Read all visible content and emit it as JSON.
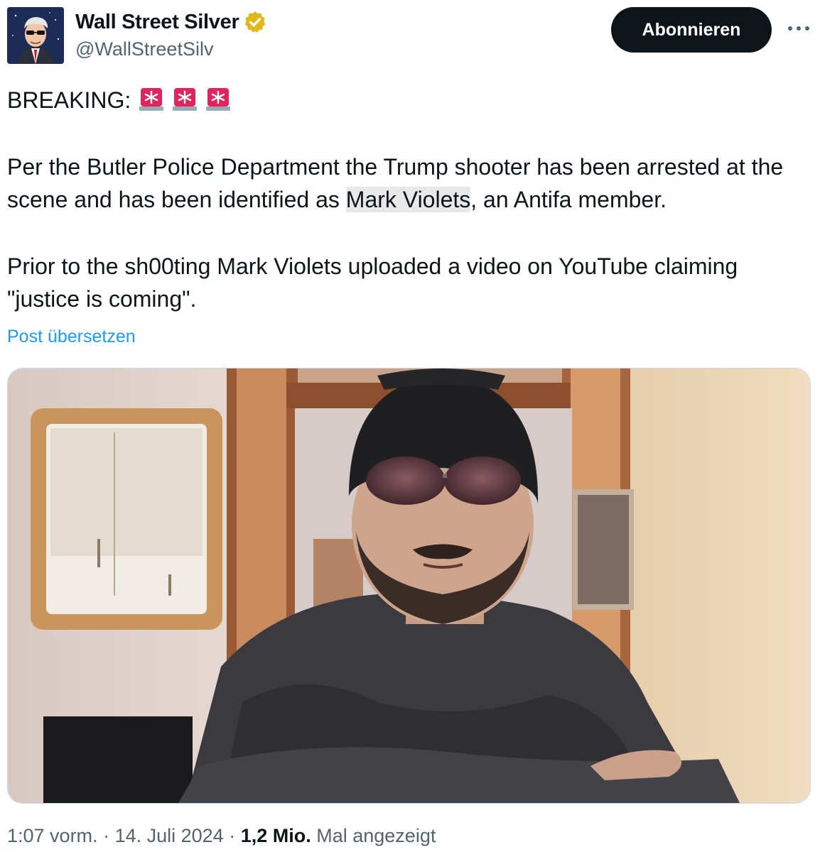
{
  "author": {
    "display_name": "Wall Street Silver",
    "handle": "@WallStreetSilv",
    "verified_color": "#e2b719"
  },
  "actions": {
    "follow_label": "Abonnieren",
    "more_label": "···"
  },
  "post": {
    "breaking_label": "BREAKING:",
    "paragraph_1_before": "Per the Butler Police Department the Trump shooter has been arrested at the scene and has been identified as ",
    "paragraph_1_highlight": "Mark Violets",
    "paragraph_1_after": ", an Antifa member.",
    "paragraph_2": "Prior to the sh00ting Mark Violets uploaded a video on YouTube claiming \"justice is coming\".",
    "translate_label": "Post übersetzen"
  },
  "meta": {
    "time": "1:07 vorm.",
    "separator": " · ",
    "date": "14. Juli 2024",
    "views_count": "1,2 Mio.",
    "views_label": "Mal angezeigt"
  },
  "colors": {
    "text": "#0f1419",
    "secondary": "#536471",
    "link": "#1d9bf0",
    "siren": "#e0245e"
  }
}
